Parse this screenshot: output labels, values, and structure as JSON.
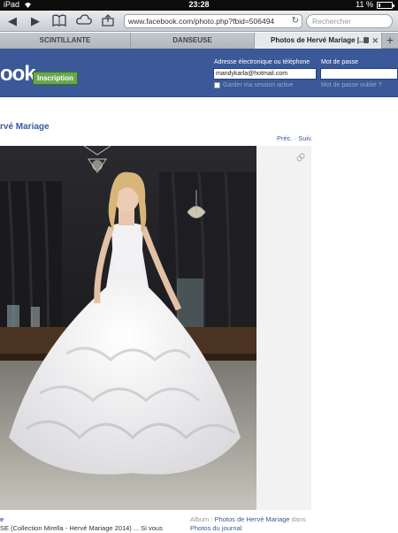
{
  "status": {
    "device": "iPad",
    "time": "23:28",
    "battery": "11 %",
    "battery_level": 0.11
  },
  "toolbar": {
    "url": "www.facebook.com/photo.php?fbid=506494",
    "search_placeholder": "Rechercher",
    "icons": [
      "back-icon",
      "forward-icon",
      "bookmarks-icon",
      "cloud-tabs-icon",
      "share-icon",
      "reload-icon"
    ]
  },
  "tabs": [
    {
      "label": "SCINTILLANTE"
    },
    {
      "label": "DANSEUSE"
    },
    {
      "label": "Photos de Hervé Mariage |..."
    }
  ],
  "fb": {
    "logo": "ook",
    "signup": "Inscription",
    "email_label": "Adresse électronique ou téléphone",
    "email_value": "mandykarla@hotmail.com",
    "password_label": "Mot de passe",
    "remember": "Garder ma session active",
    "forgot": "Mot de passe oublié ?"
  },
  "page": {
    "title": "rvé Mariage",
    "prev": "Préc.",
    "next": "Suiv.",
    "caption_name": "e",
    "caption_text": "SE (Collection Mirella - Hervé Mariage 2014) ... Si vous",
    "album_label": "Album :",
    "album_link": "Photos de Hervé Mariage",
    "album_in": "dans",
    "album_journal": "Photos du journal"
  },
  "colors": {
    "fb_blue": "#3b5998",
    "signup_green": "#69a74e"
  }
}
